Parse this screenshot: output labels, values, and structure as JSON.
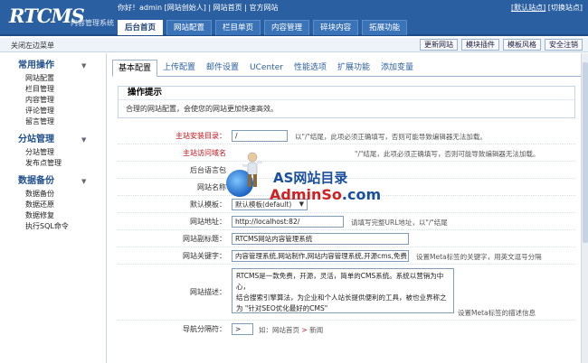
{
  "app": {
    "logo": "RTCMS",
    "logo_sub": "内容管理系统"
  },
  "top": {
    "greeting": "你好！admin [网站创始人]",
    "sep1": "|",
    "site_home": "网站首页",
    "sep2": "|",
    "official_site": "官方网站",
    "default_site": "[默认站点]",
    "manage_site": "[切换站点]"
  },
  "nav": [
    "后台首页",
    "网站配置",
    "栏目单页",
    "内容管理",
    "碎块内容",
    "拓展功能"
  ],
  "subbar": {
    "close_menu": "关闭左边菜单",
    "tools": [
      "更新网站",
      "模块插件",
      "模板风格",
      "安全注销"
    ]
  },
  "sidebar": {
    "groups": [
      {
        "title": "常用操作",
        "items": [
          "网站配置",
          "栏目管理",
          "内容管理",
          "评论管理",
          "留言管理"
        ]
      },
      {
        "title": "分站管理",
        "items": [
          "分站管理",
          "发布点管理"
        ]
      },
      {
        "title": "数据备份",
        "items": [
          "数据备份",
          "数据还原",
          "数据修复",
          "执行SQL命令"
        ]
      }
    ],
    "arrow": "▼"
  },
  "tabs": [
    "基本配置",
    "上传配置",
    "邮件设置",
    "UCenter",
    "性能选项",
    "扩展功能",
    "添加变量"
  ],
  "notice": {
    "title": "操作提示",
    "body": "合理的网站配置，会使您的网站更加快速高效。"
  },
  "form": {
    "install_dir": {
      "label": "主站安装目录：",
      "value": "/",
      "hint": "以\"/\"结尾，此项必须正确填写，否则可能导致编辑器无法加载。"
    },
    "access_domain": {
      "label": "主站访问域名",
      "hint": "\"/\"结尾，此项必须正确填写，否则可能导致编辑器无法加载。"
    },
    "admin_lang": {
      "label": "后台语言包"
    },
    "site_name": {
      "label": "网站名称"
    },
    "default_template": {
      "label": "默认模板：",
      "value": "默认模板(default)"
    },
    "site_url": {
      "label": "网站地址：",
      "value": "http://localhost:82/",
      "hint": "请填写完整URL地址，以\"/\"结尾"
    },
    "subtitle": {
      "label": "网站副标题：",
      "value": "RTCMS网站内容管理系统"
    },
    "keywords": {
      "label": "网站关键字：",
      "value": "内容管理系统,网站制作,网站内容管理系统,开源cms,免费",
      "hint": "设置Meta标签的关键字，用英文逗号分隔"
    },
    "description": {
      "label": "网站描述：",
      "lines": [
        "RTCMS是一款免费，开源，灵活，简单的CMS系统。系统以营销为中心，",
        "结合搜索引擎算法，为企业和个人站长提供便利的工具，被也业界称之",
        "为 \"针对SEO优化最好的CMS\""
      ],
      "hint": "设置Meta标签的描述信息"
    },
    "nav_sep": {
      "label": "导航分隔符：",
      "value": ">",
      "hint_prefix": "如：网站首页",
      "hint_arrow": ">",
      "hint_suffix": "新闻"
    }
  },
  "watermark": {
    "line1": "AS网站目录",
    "line2_a": "Admin",
    "line2_b": "So",
    "line2_c": ".com"
  }
}
